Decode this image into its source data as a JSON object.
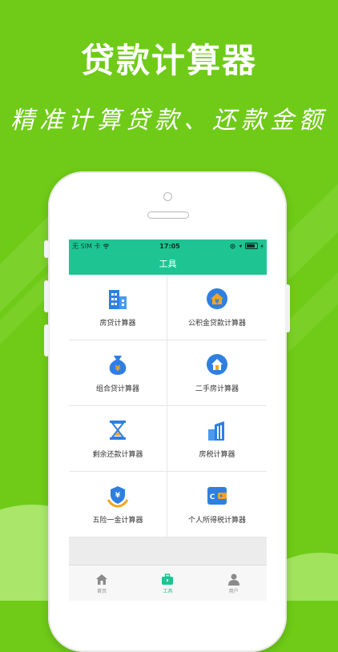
{
  "promo": {
    "title": "贷款计算器",
    "subtitle": "精准计算贷款、还款金额"
  },
  "status_bar": {
    "carrier": "无 SIM 卡",
    "time": "17:05"
  },
  "nav": {
    "title": "工具"
  },
  "tools": [
    {
      "label": "房贷计算器",
      "icon": "building-icon"
    },
    {
      "label": "公积金贷款计算器",
      "icon": "house-yen-icon"
    },
    {
      "label": "组合贷计算器",
      "icon": "money-bag-icon"
    },
    {
      "label": "二手房计算器",
      "icon": "house-refresh-icon"
    },
    {
      "label": "剩余还款计算器",
      "icon": "hourglass-icon"
    },
    {
      "label": "房税计算器",
      "icon": "office-building-icon"
    },
    {
      "label": "五险一金计算器",
      "icon": "shield-hand-icon"
    },
    {
      "label": "个人所得税计算器",
      "icon": "wallet-icon"
    }
  ],
  "tabs": [
    {
      "label": "首页",
      "icon": "home-icon"
    },
    {
      "label": "工具",
      "icon": "toolbox-icon",
      "active": true
    },
    {
      "label": "用户",
      "icon": "user-icon"
    }
  ],
  "colors": {
    "background": "#6fcb17",
    "accent": "#1fc493",
    "icon_blue": "#2f7fe0",
    "icon_orange": "#f4a51c"
  }
}
